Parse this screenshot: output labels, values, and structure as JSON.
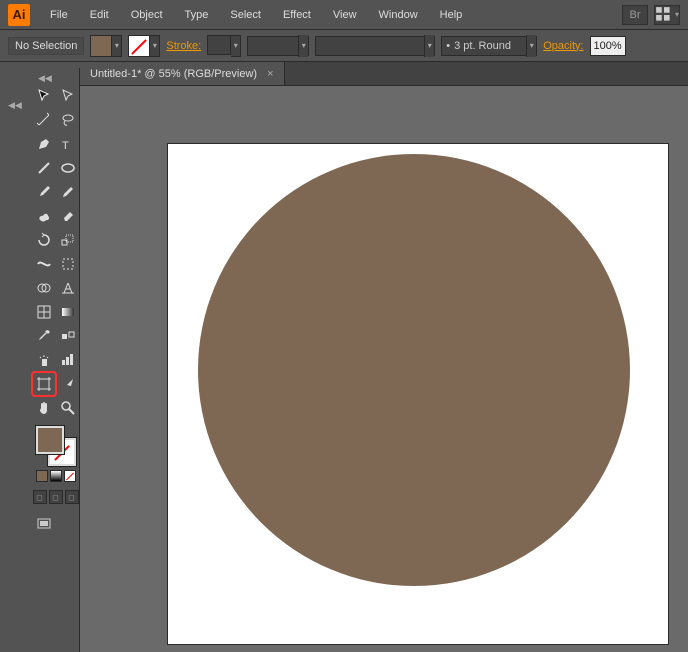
{
  "app": {
    "icon_text": "Ai"
  },
  "menu": {
    "items": [
      "File",
      "Edit",
      "Object",
      "Type",
      "Select",
      "Effect",
      "View",
      "Window",
      "Help"
    ],
    "br_label": "Br"
  },
  "control": {
    "selection_label": "No Selection",
    "stroke_label": "Stroke:",
    "stroke_value": "",
    "brush_preset": "3 pt. Round",
    "opacity_label": "Opacity:",
    "opacity_value": "100%"
  },
  "document": {
    "tab_title": "Untitled-1* @ 55% (RGB/Preview)",
    "close_glyph": "×"
  },
  "colors": {
    "fill_hex": "#7f6853",
    "stroke_state": "none"
  },
  "collapse_glyph": "◀◀",
  "dd_glyph": "▾",
  "bullet_glyph": "•"
}
